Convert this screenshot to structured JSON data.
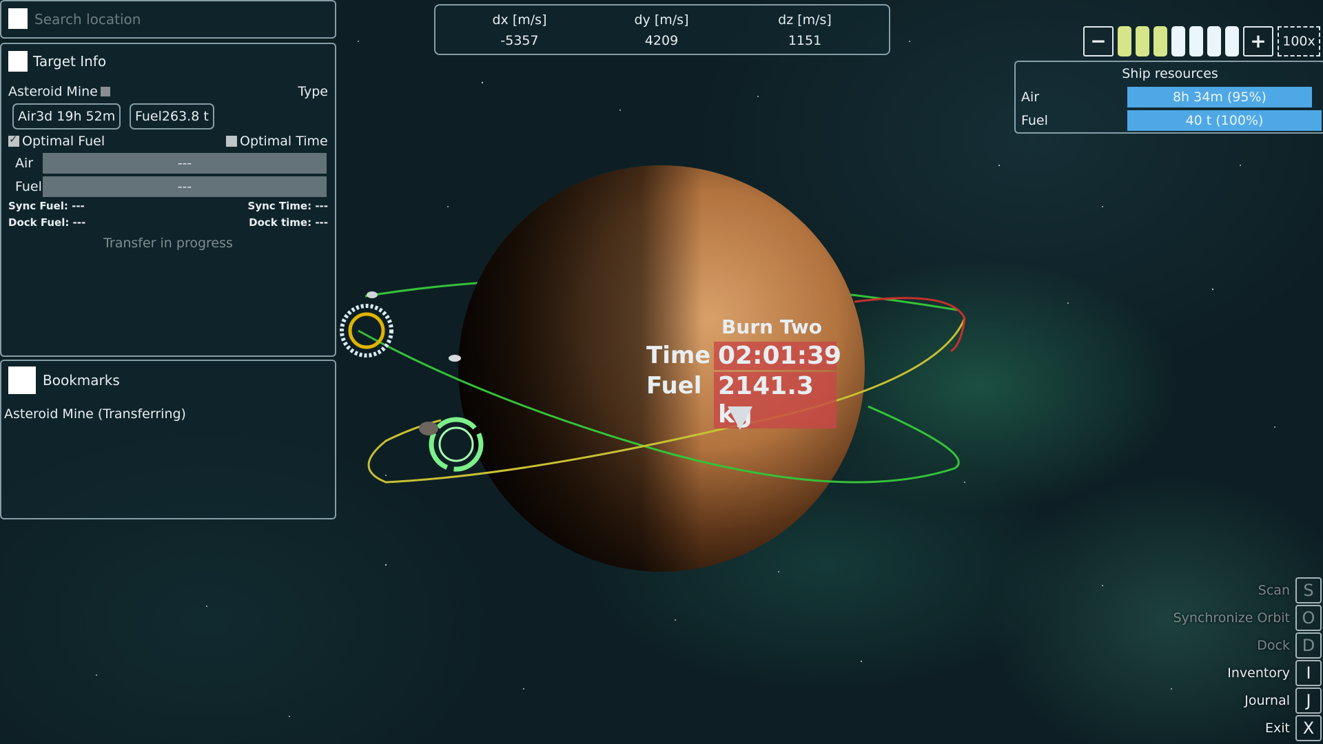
{
  "search": {
    "placeholder": "Search location"
  },
  "target_info": {
    "title": "Target Info",
    "name": "Asteroid Mine",
    "type_label": "Type",
    "air_pill": "Air3d 19h 52m",
    "fuel_pill": "Fuel263.8 t",
    "optimal_fuel": "Optimal Fuel",
    "optimal_fuel_checked": true,
    "optimal_time": "Optimal Time",
    "optimal_time_checked": false,
    "air_label": "Air",
    "air_value": "---",
    "fuel_label": "Fuel",
    "fuel_value": "---",
    "sync_fuel": "Sync Fuel: ---",
    "sync_time": "Sync Time: ---",
    "dock_fuel": "Dock Fuel: ---",
    "dock_time": "Dock time: ---",
    "status": "Transfer in progress"
  },
  "bookmarks": {
    "title": "Bookmarks",
    "items": [
      "Asteroid Mine (Transferring)"
    ]
  },
  "velocity": {
    "columns": [
      {
        "label": "dx [m/s]",
        "value": "-5357"
      },
      {
        "label": "dy [m/s]",
        "value": "4209"
      },
      {
        "label": "dz [m/s]",
        "value": "1151"
      }
    ]
  },
  "speed_control": {
    "minus": "−",
    "plus": "+",
    "multiplier": "100x",
    "segments": [
      "#d6e58a",
      "#d6e58a",
      "#d6e58a",
      "#eaf6fb",
      "#eaf6fb",
      "#eaf6fb",
      "#eaf6fb"
    ]
  },
  "ship_resources": {
    "title": "Ship resources",
    "air_label": "Air",
    "air_value": "8h 34m (95%)",
    "air_fraction": 0.95,
    "fuel_label": "Fuel",
    "fuel_value": "40 t (100%)",
    "fuel_fraction": 1.0
  },
  "burn": {
    "name": "Burn Two",
    "time_label": "Time",
    "time_value": "02:01:39",
    "fuel_label": "Fuel",
    "fuel_value": "2141.3 kg"
  },
  "actions": [
    {
      "label": "Scan",
      "key": "S",
      "enabled": false
    },
    {
      "label": "Synchronize Orbit",
      "key": "O",
      "enabled": false
    },
    {
      "label": "Dock",
      "key": "D",
      "enabled": false
    },
    {
      "label": "Inventory",
      "key": "I",
      "enabled": true
    },
    {
      "label": "Journal",
      "key": "J",
      "enabled": true
    },
    {
      "label": "Exit",
      "key": "X",
      "enabled": true
    }
  ],
  "colors": {
    "orbit_green": "#35c23a",
    "orbit_yellow": "#c8c034",
    "orbit_red": "#c8302a",
    "burn_highlight": "#c84646",
    "resource_bar": "#4fa8e6"
  }
}
